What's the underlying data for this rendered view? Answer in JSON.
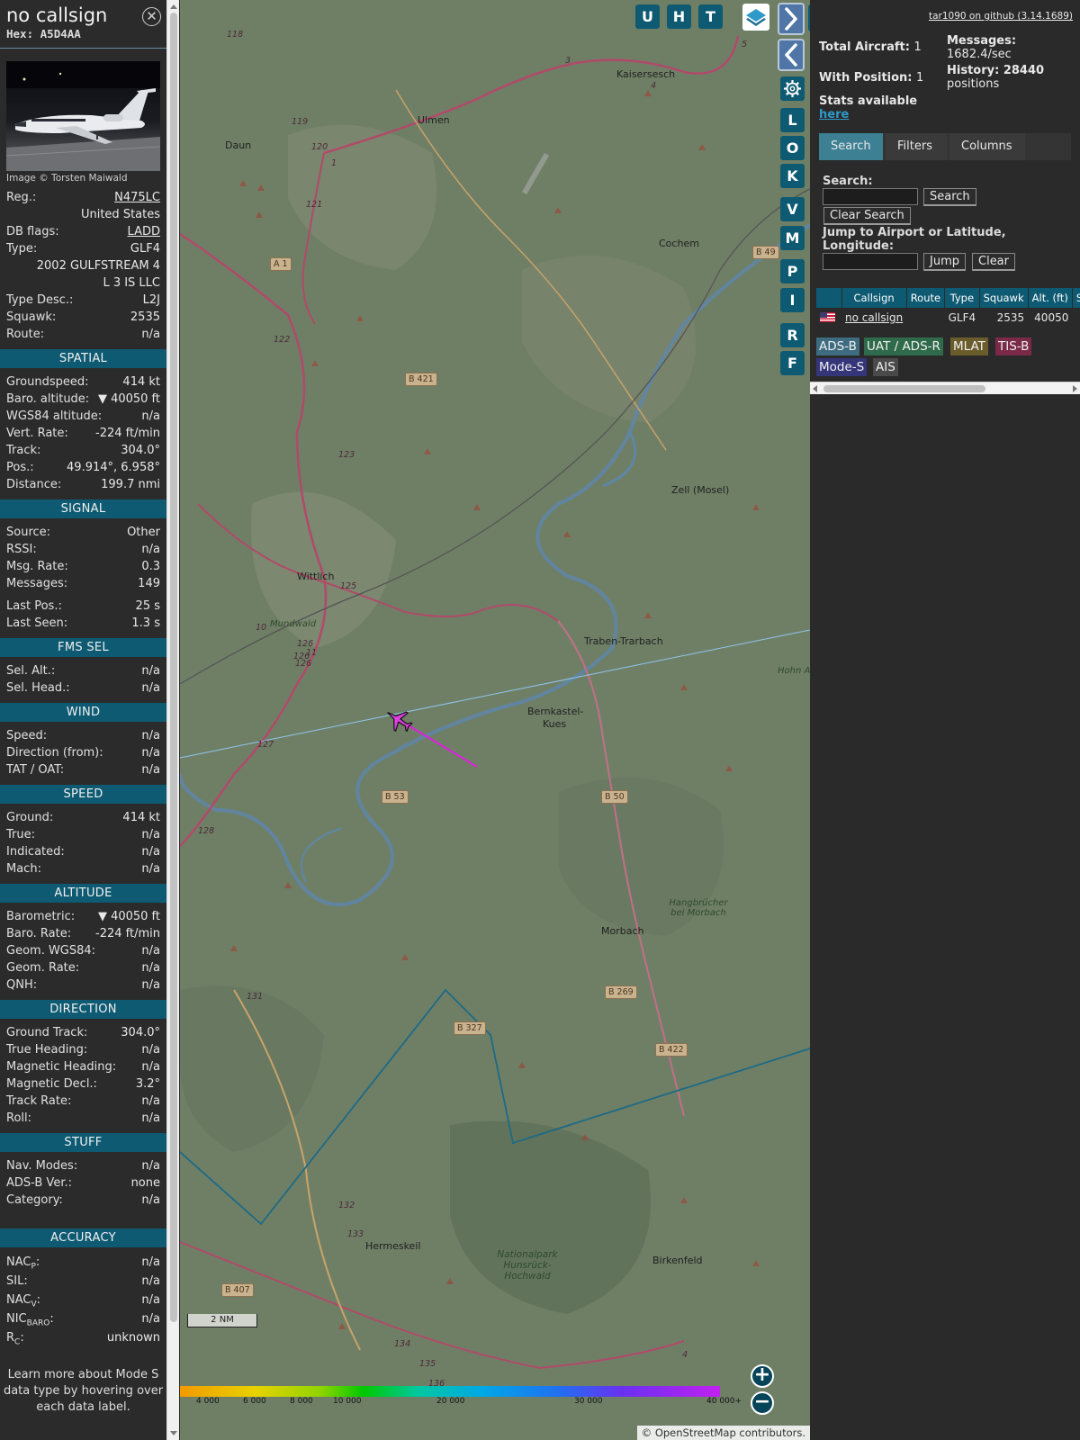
{
  "info": {
    "callsign": "no callsign",
    "hex_label": "Hex:",
    "hex": "A5D4AA",
    "image_credit": "Image © Torsten Maiwald",
    "fields_top": [
      {
        "key": "Reg.:",
        "value": "N475LC",
        "link": true
      },
      {
        "key": "",
        "value": "United States"
      },
      {
        "key": "DB flags:",
        "value": "LADD",
        "link": true
      },
      {
        "key": "Type:",
        "value": "GLF4"
      },
      {
        "key": "",
        "value": "2002 GULFSTREAM 4"
      },
      {
        "key": "",
        "value": "L 3 IS LLC"
      },
      {
        "key": "Type Desc.:",
        "value": "L2J"
      },
      {
        "key": "Squawk:",
        "value": "2535"
      },
      {
        "key": "Route:",
        "value": "n/a"
      }
    ],
    "sections": [
      {
        "title": "SPATIAL",
        "rows": [
          {
            "key": "Groundspeed:",
            "value": "414 kt"
          },
          {
            "key": "Baro. altitude:",
            "value": "▼ 40050 ft"
          },
          {
            "key": "WGS84 altitude:",
            "value": "n/a"
          },
          {
            "key": "Vert. Rate:",
            "value": "-224 ft/min"
          },
          {
            "key": "Track:",
            "value": "304.0°"
          },
          {
            "key": "Pos.:",
            "value": "49.914°, 6.958°"
          },
          {
            "key": "Distance:",
            "value": "199.7 nmi"
          }
        ]
      },
      {
        "title": "SIGNAL",
        "rows": [
          {
            "key": "Source:",
            "value": "Other"
          },
          {
            "key": "RSSI:",
            "value": "n/a"
          },
          {
            "key": "Msg. Rate:",
            "value": "0.3"
          },
          {
            "key": "Messages:",
            "value": "149"
          },
          {
            "key": "Last Pos.:",
            "value": "25 s",
            "gap": true
          },
          {
            "key": "Last Seen:",
            "value": "1.3 s"
          }
        ]
      },
      {
        "title": "FMS SEL",
        "rows": [
          {
            "key": "Sel. Alt.:",
            "value": "n/a"
          },
          {
            "key": "Sel. Head.:",
            "value": "n/a"
          }
        ]
      },
      {
        "title": "WIND",
        "rows": [
          {
            "key": "Speed:",
            "value": "n/a"
          },
          {
            "key": "Direction (from):",
            "value": "n/a"
          },
          {
            "key": "TAT / OAT:",
            "value": "n/a"
          }
        ]
      },
      {
        "title": "SPEED",
        "rows": [
          {
            "key": "Ground:",
            "value": "414 kt"
          },
          {
            "key": "True:",
            "value": "n/a"
          },
          {
            "key": "Indicated:",
            "value": "n/a"
          },
          {
            "key": "Mach:",
            "value": "n/a"
          }
        ]
      },
      {
        "title": "ALTITUDE",
        "rows": [
          {
            "key": "Barometric:",
            "value": "▼ 40050 ft"
          },
          {
            "key": "Baro. Rate:",
            "value": "-224 ft/min"
          },
          {
            "key": "Geom. WGS84:",
            "value": "n/a"
          },
          {
            "key": "Geom. Rate:",
            "value": "n/a"
          },
          {
            "key": "QNH:",
            "value": "n/a"
          }
        ]
      },
      {
        "title": "DIRECTION",
        "rows": [
          {
            "key": "Ground Track:",
            "value": "304.0°"
          },
          {
            "key": "True Heading:",
            "value": "n/a"
          },
          {
            "key": "Magnetic Heading:",
            "value": "n/a"
          },
          {
            "key": "Magnetic Decl.:",
            "value": "3.2°"
          },
          {
            "key": "Track Rate:",
            "value": "n/a"
          },
          {
            "key": "Roll:",
            "value": "n/a"
          }
        ]
      },
      {
        "title": "STUFF",
        "rows": [
          {
            "key": "Nav. Modes:",
            "value": "n/a"
          },
          {
            "key": "ADS-B Ver.:",
            "value": "none"
          },
          {
            "key": "Category:",
            "value": "n/a"
          }
        ]
      }
    ],
    "accuracy_title": "ACCURACY",
    "accuracy": [
      {
        "key": "NAC",
        "sub": "P",
        "value": "n/a"
      },
      {
        "key": "SIL:",
        "sub": "",
        "value": "n/a"
      },
      {
        "key": "NAC",
        "sub": "V",
        "value": "n/a"
      },
      {
        "key": "NIC",
        "sub": "BARO",
        "value": "n/a"
      },
      {
        "key": "R",
        "sub": "C",
        "value": "unknown"
      }
    ],
    "note": "Learn more about Mode S data type by hovering over each data label."
  },
  "map": {
    "buttons_top": [
      "U",
      "H",
      "T"
    ],
    "buttons_side": [
      "L",
      "O",
      "K",
      "V",
      "M",
      "P",
      "I",
      "R",
      "F"
    ],
    "places": [
      "Kaisersesch",
      "Ulmen",
      "Daun",
      "Cochem",
      "Zell (Mosel)",
      "Wittlich",
      "Traben-Trarbach",
      "Bernkastel-",
      "Kues",
      "Morbach",
      "Hermeskeil",
      "Birkenfeld"
    ],
    "nature_labels": [
      "Mundwald",
      "Hohn Air",
      "Hangbrücher bei Morbach",
      "Nationalpark Hunsrück-Hochwald"
    ],
    "road_shields": [
      "A 1",
      "B 49",
      "B 421",
      "B 53",
      "B 50",
      "B 269",
      "B 327",
      "B 422",
      "B 407"
    ],
    "route_numbers": [
      "118",
      "119",
      "120",
      "121",
      "1",
      "3",
      "4",
      "5",
      "122",
      "123",
      "125",
      "126",
      "126",
      "11",
      "10",
      "126",
      "127",
      "128",
      "131",
      "132",
      "133",
      "134",
      "135",
      "136",
      "4"
    ],
    "altitude_ticks": [
      "4 000",
      "6 000",
      "8 000",
      "10 000",
      "20 000",
      "30 000",
      "40 000+"
    ],
    "scale": "2 NM",
    "attribution_symbol": "©",
    "attribution_link": "OpenStreetMap",
    "attribution_rest": "contributors."
  },
  "sidebar": {
    "github": "tar1090 on github (3.14.1689)",
    "total_label": "Total Aircraft:",
    "total": "1",
    "withpos_label": "With Position:",
    "withpos": "1",
    "stats_label": "Stats available",
    "stats_link": "here",
    "messages_label": "Messages:",
    "messages": "1682.4/sec",
    "history_label": "History: 28440",
    "history_unit": "positions",
    "tabs": [
      "Search",
      "Filters",
      "Columns"
    ],
    "search_label": "Search:",
    "search_button": "Search",
    "clear_search_button": "Clear Search",
    "jump_label": "Jump to Airport or Latitude, Longitude:",
    "jump_button": "Jump",
    "clear_button": "Clear",
    "table": {
      "headers": [
        "",
        "Callsign",
        "Route",
        "Type",
        "Squawk",
        "Alt. (ft)",
        "S"
      ],
      "rows": [
        [
          "",
          "no callsign",
          "",
          "GLF4",
          "2535",
          "40050",
          ""
        ]
      ]
    },
    "sources": [
      {
        "label": "ADS-B",
        "color": "#3d6c80"
      },
      {
        "label": "UAT / ADS-R",
        "color": "#2f6a4a"
      },
      {
        "label": "MLAT",
        "color": "#6b5c2c"
      },
      {
        "label": "TIS-B",
        "color": "#7a2a48"
      },
      {
        "label": "Mode-S",
        "color": "#35357a"
      },
      {
        "label": "AIS",
        "color": "#4a4a4a"
      }
    ]
  }
}
